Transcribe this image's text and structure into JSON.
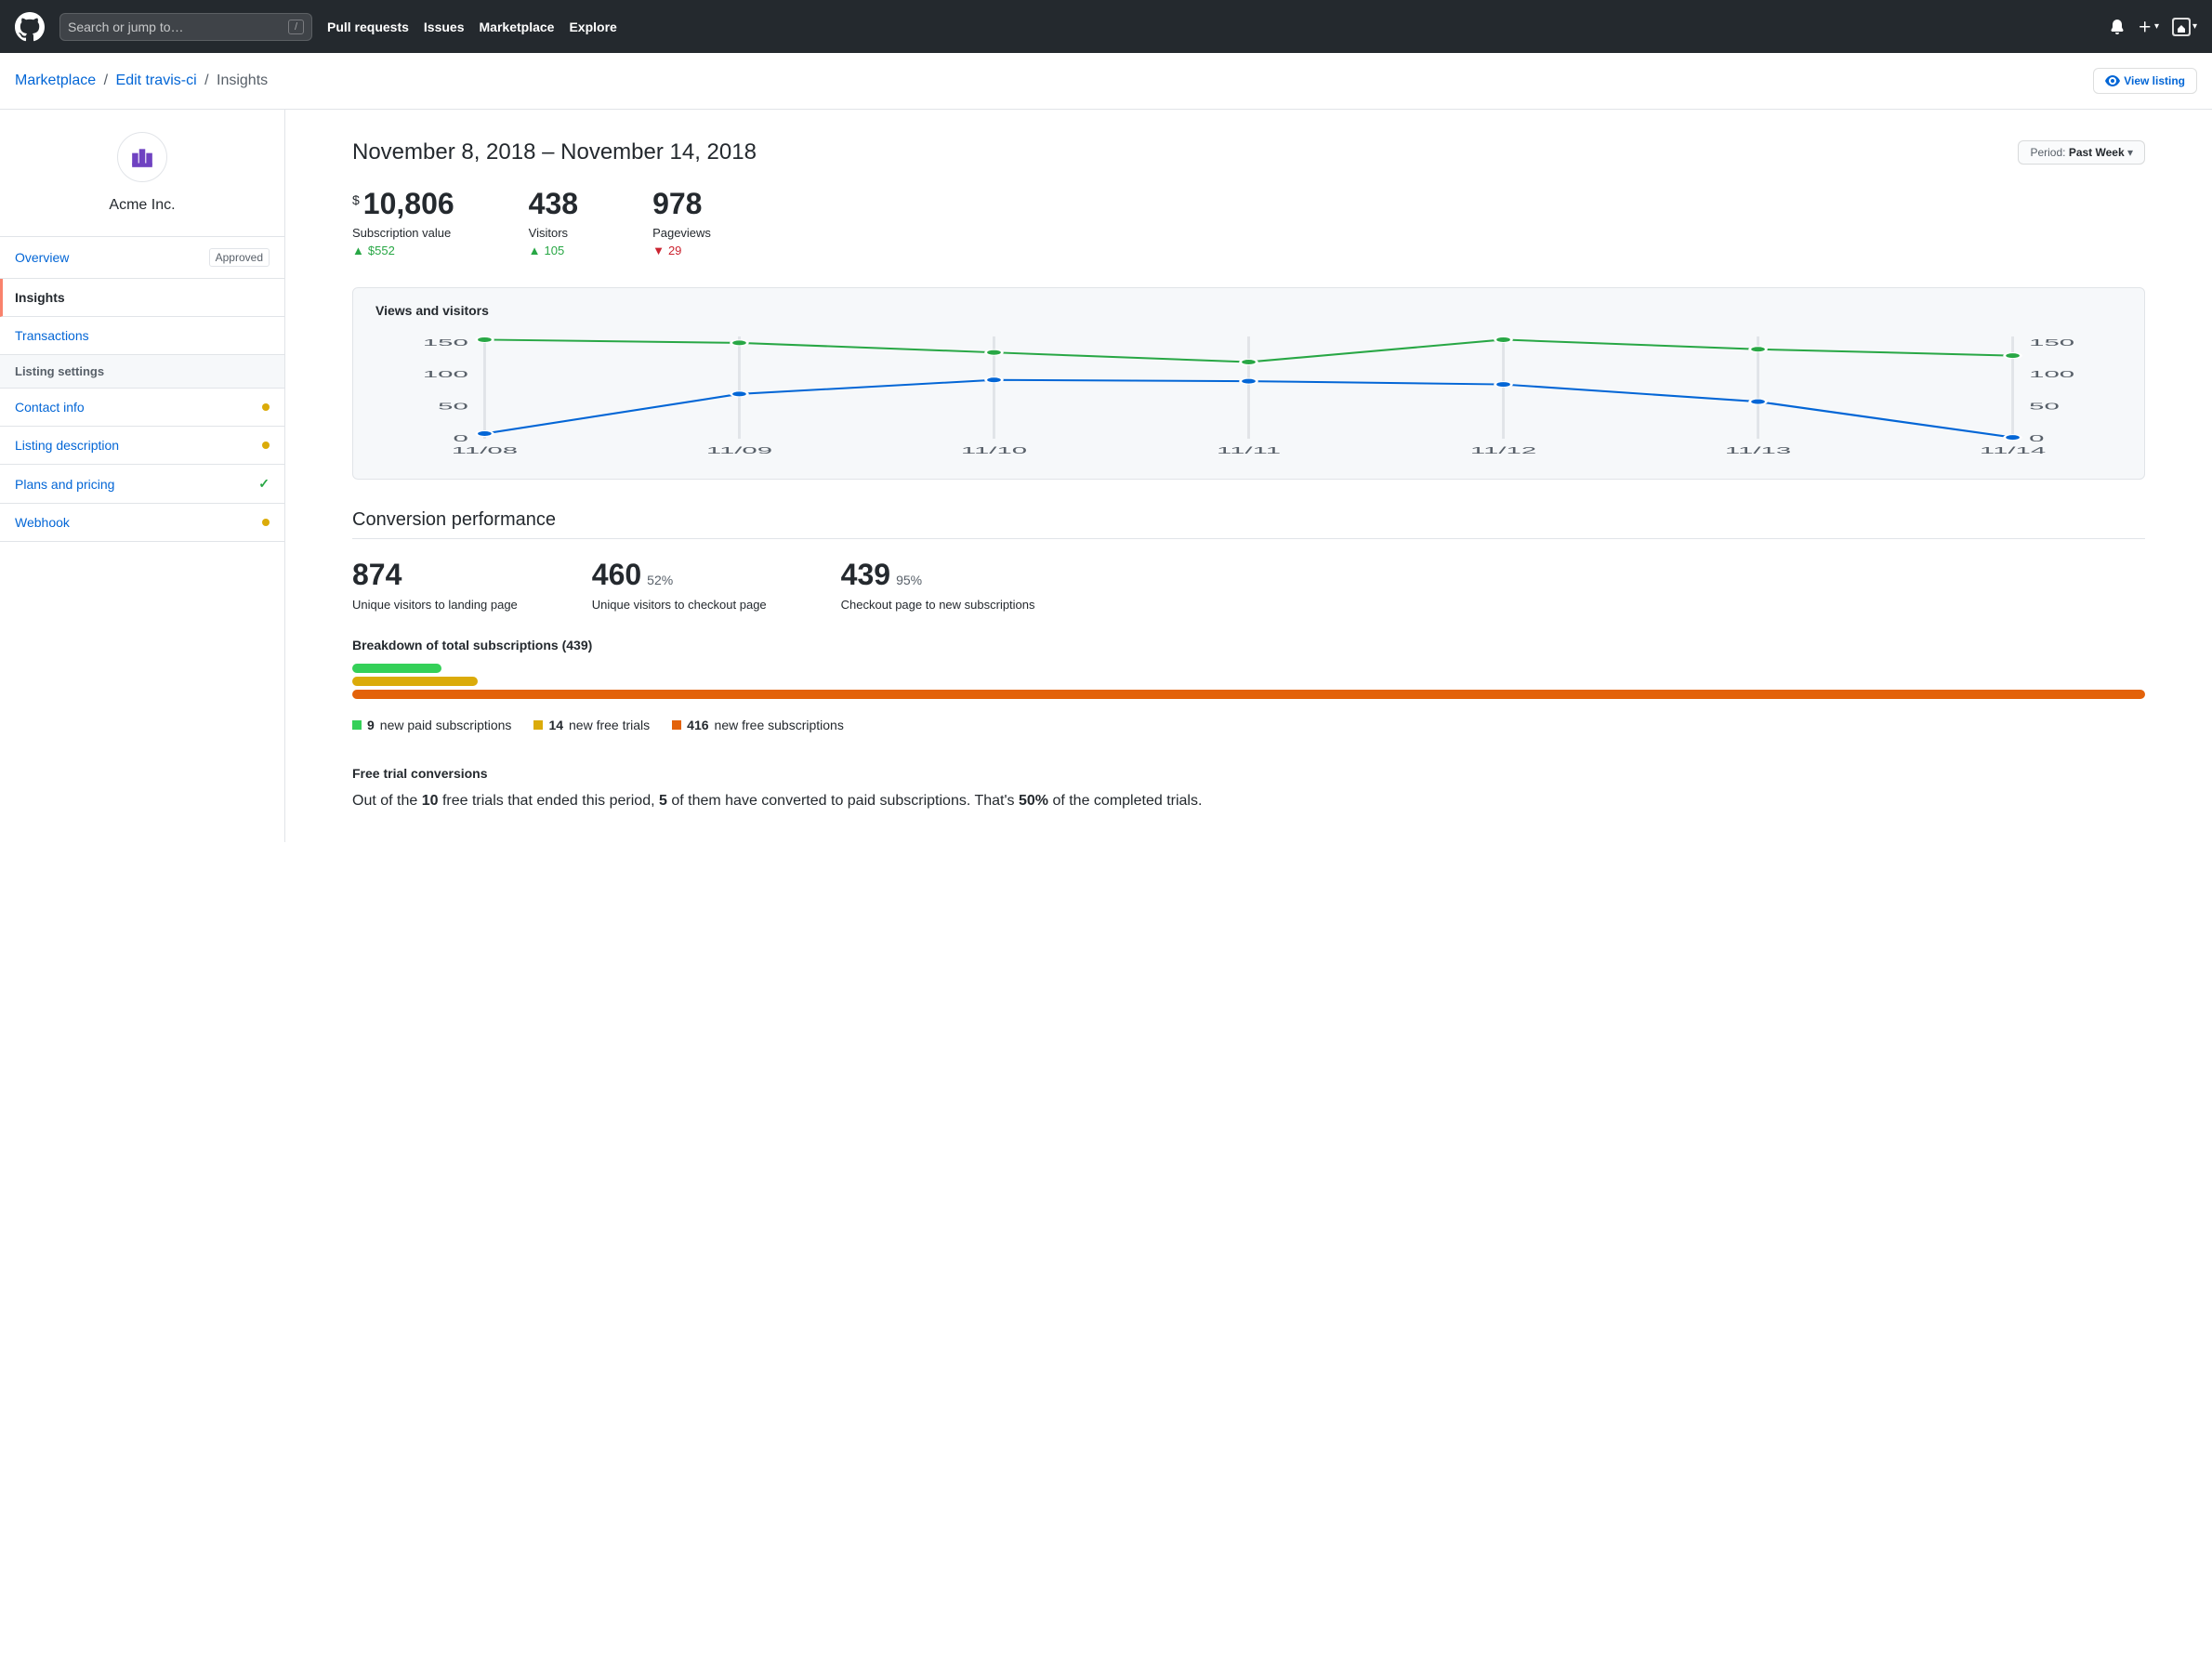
{
  "nav": {
    "search_placeholder": "Search or jump to…",
    "links": [
      "Pull requests",
      "Issues",
      "Marketplace",
      "Explore"
    ]
  },
  "breadcrumb": {
    "a": "Marketplace",
    "b": "Edit travis-ci",
    "current": "Insights",
    "view_listing": "View listing"
  },
  "sidebar": {
    "org": "Acme Inc.",
    "items": [
      {
        "label": "Overview",
        "badge": "Approved"
      },
      {
        "label": "Insights",
        "active": true
      },
      {
        "label": "Transactions"
      }
    ],
    "settings_header": "Listing settings",
    "settings": [
      {
        "label": "Contact info",
        "status": "dot"
      },
      {
        "label": "Listing description",
        "status": "dot"
      },
      {
        "label": "Plans and pricing",
        "status": "check"
      },
      {
        "label": "Webhook",
        "status": "dot"
      }
    ]
  },
  "content": {
    "date_range": "November 8, 2018 – November 14, 2018",
    "period_prefix": "Period: ",
    "period_value": "Past Week",
    "metrics": [
      {
        "prefix": "$",
        "value": "10,806",
        "label": "Subscription value",
        "delta": "$552",
        "dir": "up"
      },
      {
        "value": "438",
        "label": "Visitors",
        "delta": "105",
        "dir": "up"
      },
      {
        "value": "978",
        "label": "Pageviews",
        "delta": "29",
        "dir": "down"
      }
    ],
    "chart_title": "Views and visitors"
  },
  "conversion": {
    "title": "Conversion performance",
    "metrics": [
      {
        "value": "874",
        "pct": "",
        "label": "Unique visitors to landing page"
      },
      {
        "value": "460",
        "pct": "52%",
        "label": "Unique visitors to checkout page"
      },
      {
        "value": "439",
        "pct": "95%",
        "label": "Checkout page to new subscriptions"
      }
    ],
    "breakdown_title": "Breakdown of total subscriptions (439)",
    "legend": [
      {
        "count": "9",
        "text": " new paid subscriptions"
      },
      {
        "count": "14",
        "text": " new free trials"
      },
      {
        "count": "416",
        "text": " new free subscriptions"
      }
    ],
    "ft_title": "Free trial conversions",
    "ft_p1a": "Out of the ",
    "ft_p1b": "10",
    "ft_p1c": " free trials that ended this period, ",
    "ft_p1d": "5",
    "ft_p1e": " of them have converted to paid subscriptions. That's ",
    "ft_p1f": "50%",
    "ft_p1g": " of the completed trials."
  },
  "chart_data": {
    "type": "line",
    "title": "Views and visitors",
    "xlabel": "",
    "ylabel": "",
    "ylim": [
      0,
      160
    ],
    "categories": [
      "11/08",
      "11/09",
      "11/10",
      "11/11",
      "11/12",
      "11/13",
      "11/14"
    ],
    "series": [
      {
        "name": "views",
        "color": "#28a745",
        "values": [
          155,
          150,
          135,
          120,
          155,
          140,
          130
        ]
      },
      {
        "name": "visitors",
        "color": "#0366d6",
        "values": [
          8,
          70,
          92,
          90,
          85,
          58,
          2
        ]
      }
    ],
    "left_ticks": [
      0,
      50,
      100,
      150
    ],
    "right_ticks": [
      0,
      50,
      100,
      150
    ]
  }
}
